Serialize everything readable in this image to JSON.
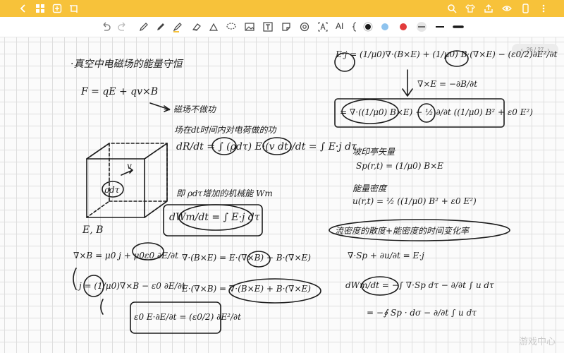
{
  "topbar": {
    "color": "#f7c23a",
    "left_icons": [
      "back-icon",
      "grid-icon",
      "add-page-icon",
      "crop-icon"
    ],
    "right_icons": [
      "search-icon",
      "shirt-icon",
      "share-icon",
      "eye-icon",
      "phone-icon",
      "more-icon"
    ]
  },
  "toolbar": {
    "tools": [
      "undo-icon",
      "redo-icon",
      "pen-icon",
      "pencil-icon",
      "highlighter-icon",
      "eraser-icon",
      "lasso-icon",
      "image-icon",
      "textbox-icon",
      "shapes-icon",
      "sticker-icon",
      "text-recognize-icon",
      "ai-label",
      "bracket-icon"
    ],
    "ai_label": "AI",
    "colors": [
      "#1a1a1a",
      "#8ec3ee",
      "#e23b3b",
      "#1a1a1a",
      "#1a1a1a",
      "#1a1a1a"
    ]
  },
  "page": {
    "indicator": "26 / 27"
  },
  "notes": {
    "title": "·真空中电磁场的能量守恒",
    "force": "F = qE + qv×B",
    "force_note": "→ 磁场不做功",
    "work_note": "场在dt时间内对电荷做的功",
    "dr_dt": "dR/dt = ∫ (ρdτ) E·(v dt)/dt = ∫ E·j dτ",
    "wm_note": "即 ρdτ增加的机械能 Wm",
    "dwm": "dWm/dt = ∫ E·j dτ",
    "cube_label": "E, B",
    "rho_label": "ρdτ",
    "v_label": "v",
    "curlB": "∇×B = μ0 j + μ0ε0 ∂E/∂t",
    "j_expr": "j = (1/μ0)∇×B − ε0 ∂E/∂t",
    "div_expr": "∇·(B×E) = E·(∇×B) − B·(∇×E)",
    "edot": "E·(∇×B) = ∇·(B×E) + B·(∇×E)",
    "eede": "ε0 E·∂E/∂t = (ε0/2) ∂E²/∂t",
    "ej_top": "E·j = (1/μ0)∇·(B×E) + (1/μ0) B·(∇×E) − (ε0/2)∂E²/∂t",
    "curlE": "∇×E = −∂B/∂t",
    "ej_boxed": "= ∇·((1/μ0) B×E) − ½ ∂/∂t ((1/μ0) B² + ε0 E²)",
    "poynting_title": "坡印亭矢量",
    "poynting": "Sp(r,t) = (1/μ0) B×E",
    "energy_density_title": "能量密度",
    "energy_density": "u(r,t) = ½ ((1/μ0) B² + ε0 E²)",
    "circled_note": "流密度的散度+能密度的时间变化率",
    "continuity": "∇·Sp + ∂u/∂t = E·j",
    "dwm_final": "dWm/dt = −∫ ∇·Sp dτ − ∂/∂t ∫ u dτ",
    "dwm_final2": "= −∮ Sp · dσ − ∂/∂t ∫ u dτ",
    "watermark": "游戏中心"
  }
}
